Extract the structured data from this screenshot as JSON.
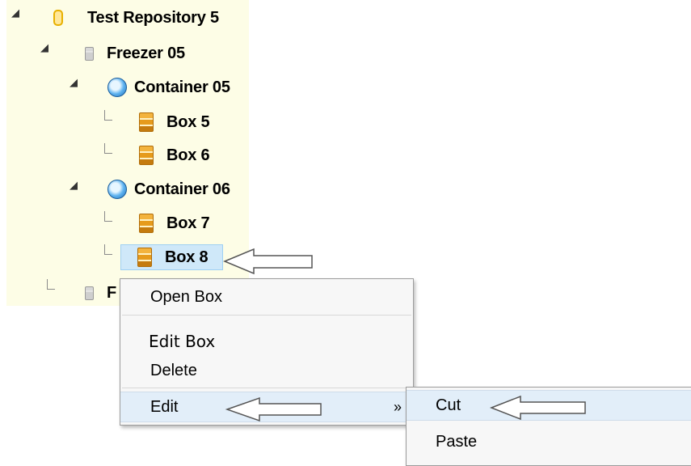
{
  "tree": {
    "repository": {
      "label": "Test Repository 5",
      "icon": "repository-icon"
    },
    "freezer_a": {
      "label": "Freezer 05",
      "icon": "freezer-icon"
    },
    "container_a": {
      "label": "Container 05",
      "icon": "container-icon"
    },
    "box_5": {
      "label": "Box 5",
      "icon": "box-icon"
    },
    "box_6": {
      "label": "Box 6",
      "icon": "box-icon"
    },
    "container_b": {
      "label": "Container 06",
      "icon": "container-icon"
    },
    "box_7": {
      "label": "Box 7",
      "icon": "box-icon"
    },
    "box_8": {
      "label": "Box 8",
      "icon": "box-icon",
      "selected": true
    },
    "freezer_b": {
      "label": "F",
      "icon": "freezer-icon"
    }
  },
  "context_menu": {
    "open_box": "Open Box",
    "edit_box": "Edit Box",
    "delete": "Delete",
    "edit": "Edit",
    "submenu_indicator": "»"
  },
  "submenu": {
    "cut": "Cut",
    "paste": "Paste"
  },
  "colors": {
    "tree_background": "#fdfde6",
    "selection": "#cfe8f9",
    "menu_background": "#f7f7f7",
    "menu_hover": "#e2eef9"
  }
}
